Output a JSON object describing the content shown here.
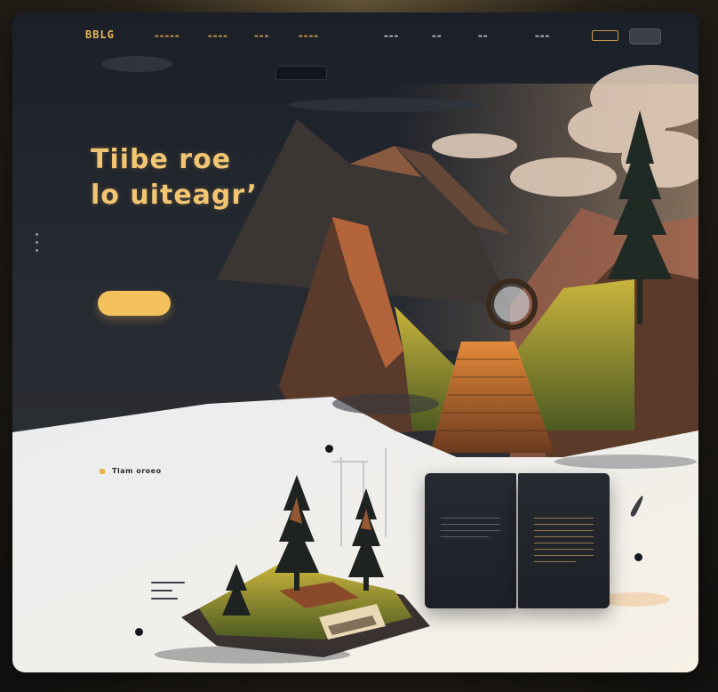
{
  "nav": {
    "brand": "BBLG",
    "links": [
      "",
      "",
      "",
      "",
      "",
      "",
      "",
      ""
    ],
    "button": "",
    "top_pill": ""
  },
  "hero": {
    "eyebrow": "",
    "headline_line1": "Tiibe roe",
    "headline_line2": "lo uiteagr’",
    "paragraph": "",
    "cta": ""
  },
  "feature": {
    "label": "Tlam oroeo",
    "paragraph": ""
  },
  "book": {
    "left_title": "",
    "right_title": ""
  },
  "colors": {
    "accent": "#f2c15c",
    "dark_bg": "#1b1f27",
    "light_bg": "#eef0f2"
  }
}
